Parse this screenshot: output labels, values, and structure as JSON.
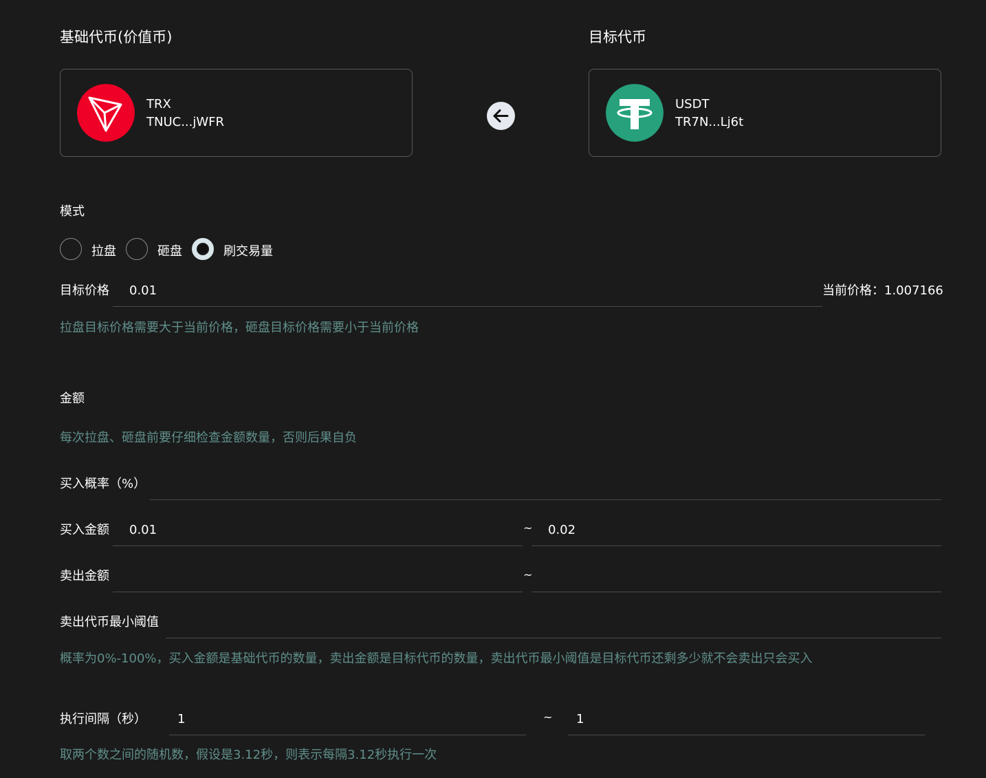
{
  "base": {
    "title": "基础代币(价值币)",
    "symbol": "TRX",
    "address": "TNUC...jWFR",
    "logo": "trx-logo-icon",
    "logo_color": "#ef0027"
  },
  "target": {
    "title": "目标代币",
    "symbol": "USDT",
    "address": "TR7N...Lj6t",
    "logo": "usdt-logo-icon",
    "logo_color": "#26a17b"
  },
  "swap_icon": "arrow-left-icon",
  "mode": {
    "title": "模式",
    "options": [
      {
        "label": "拉盘",
        "checked": false
      },
      {
        "label": "砸盘",
        "checked": false
      },
      {
        "label": "刷交易量",
        "checked": true
      }
    ]
  },
  "target_price": {
    "label": "目标价格",
    "value": "0.01",
    "current_label": "当前价格：",
    "current_value": "1.007166",
    "hint": "拉盘目标价格需要大于当前价格，砸盘目标价格需要小于当前价格"
  },
  "amount": {
    "title": "金额",
    "hint": "每次拉盘、砸盘前要仔细检查金额数量，否则后果自负",
    "buy_probability_label": "买入概率（%）",
    "buy_probability_value": "",
    "buy_amount_label": "买入金额",
    "buy_amount_min": "0.01",
    "buy_amount_max": "0.02",
    "sell_amount_label": "卖出金额",
    "sell_amount_min": "",
    "sell_amount_max": "",
    "min_threshold_label": "卖出代币最小阈值",
    "min_threshold_value": "",
    "tilde": "~",
    "hint2": "概率为0%-100%，买入金额是基础代币的数量，卖出金额是目标代币的数量，卖出代币最小阈值是目标代币还剩多少就不会卖出只会买入"
  },
  "interval": {
    "label": "执行间隔（秒）",
    "min": "1",
    "max": "1",
    "tilde": "~",
    "hint": "取两个数之间的随机数，假设是3.12秒，则表示每隔3.12秒执行一次"
  }
}
